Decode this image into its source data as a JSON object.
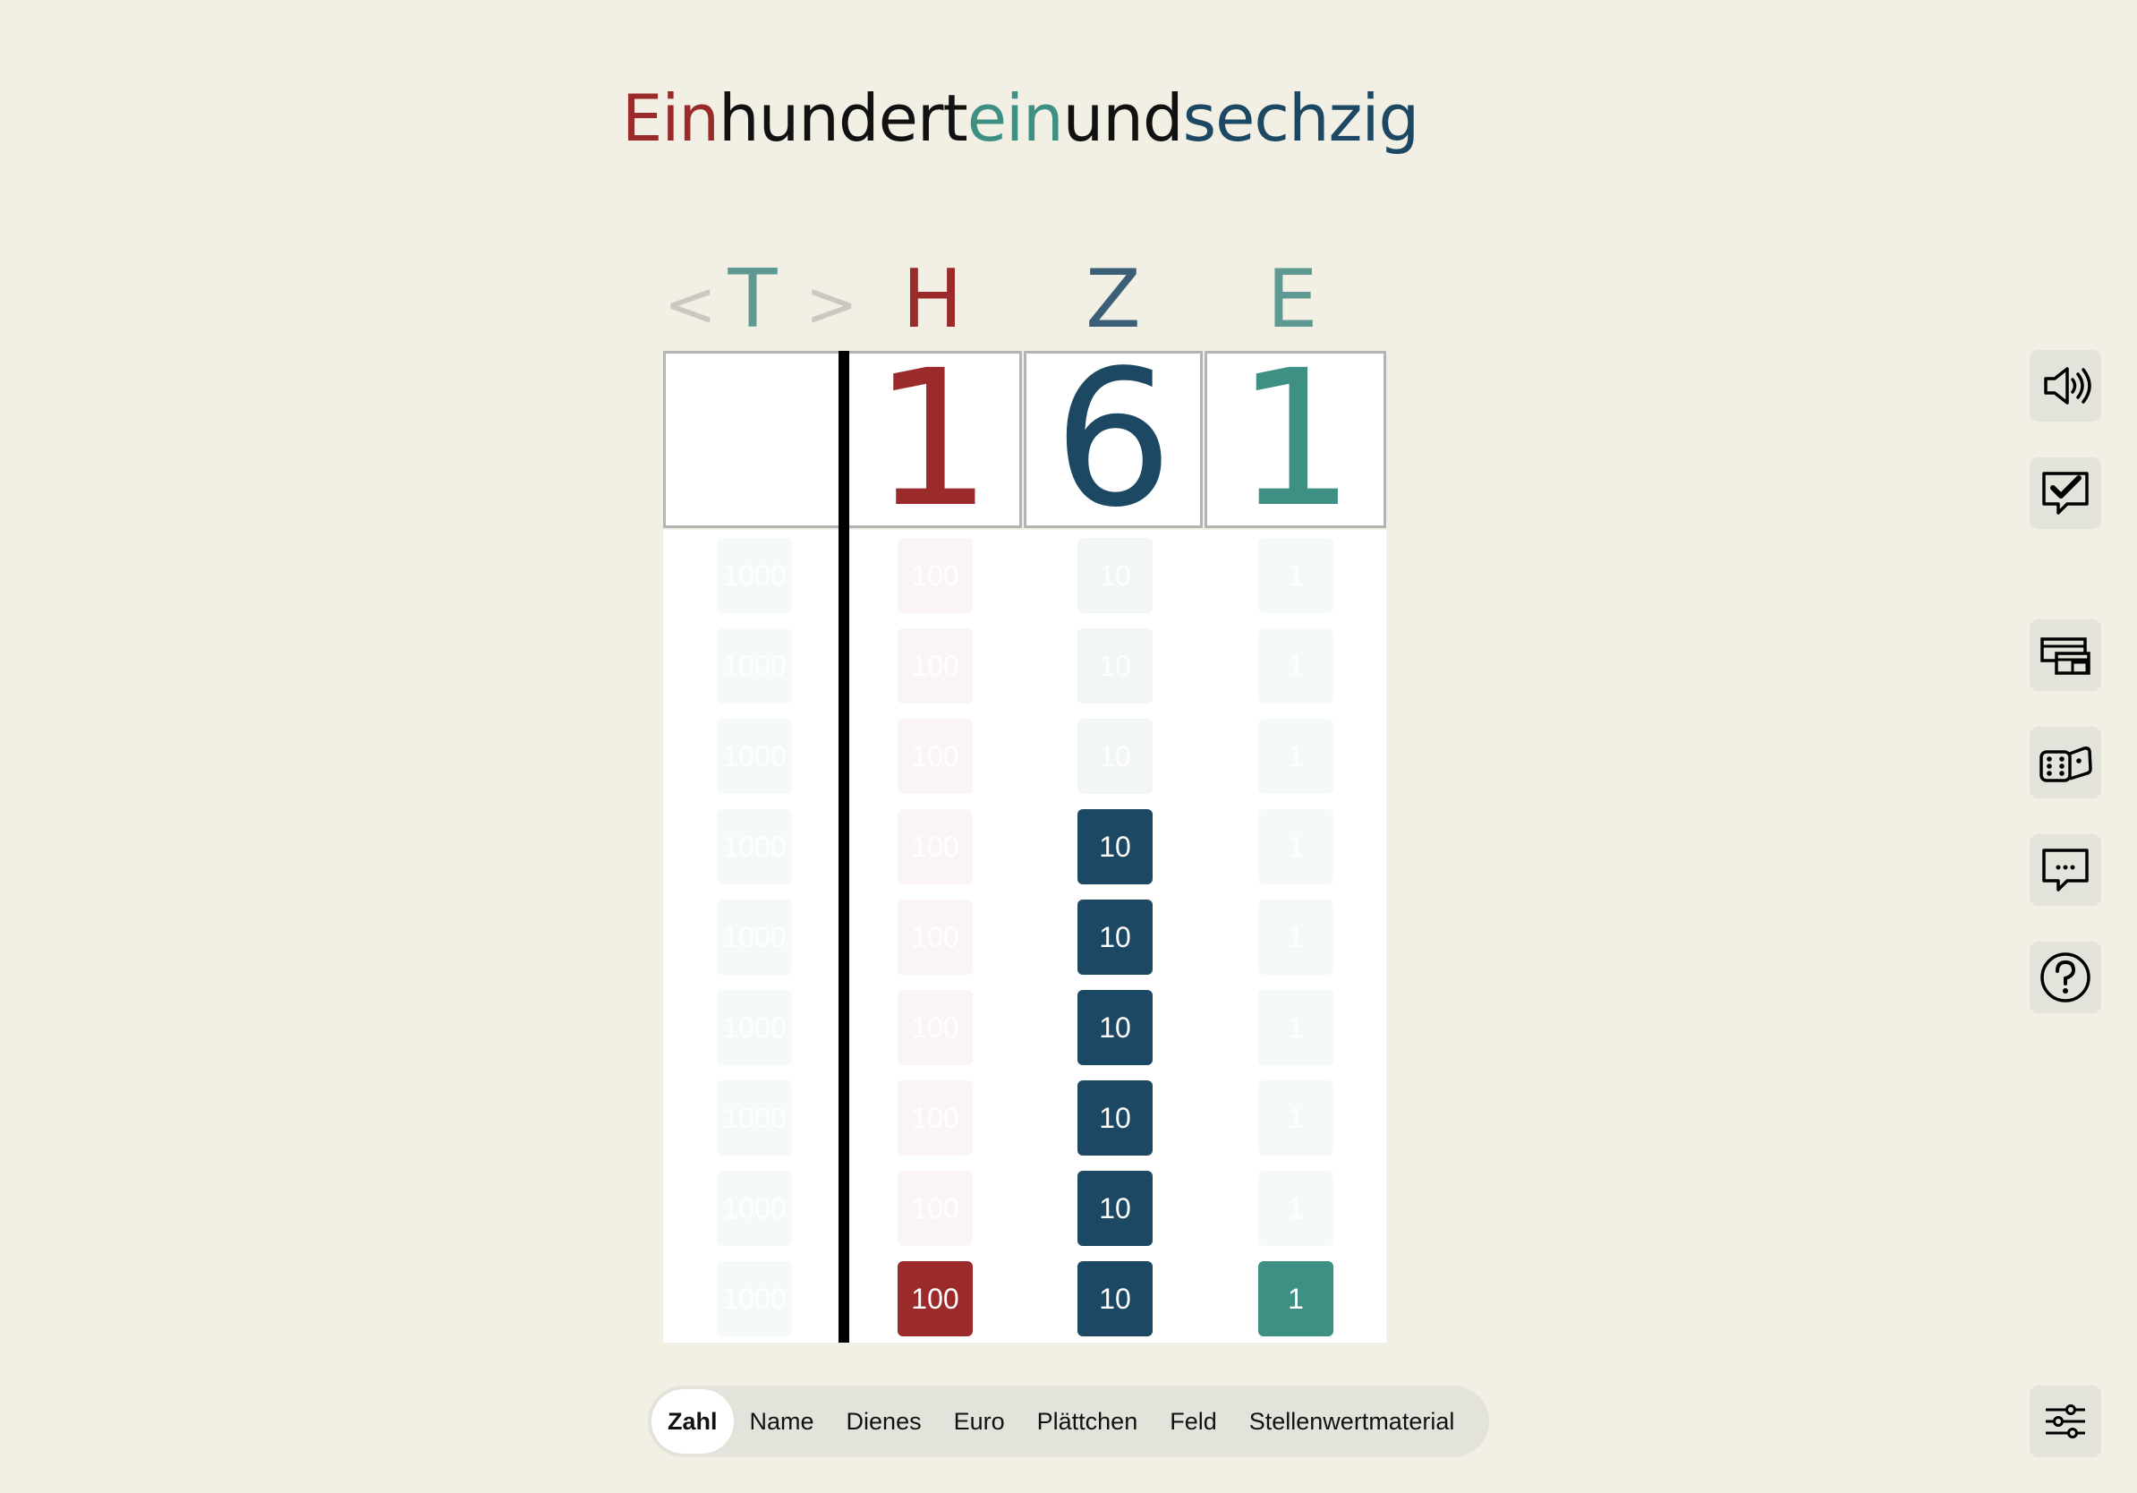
{
  "title": {
    "parts": [
      {
        "text": "Ein",
        "color": "#9b2a2a"
      },
      {
        "text": "hundert",
        "color": "#111111"
      },
      {
        "text": "ein",
        "color": "#3e8f84"
      },
      {
        "text": "und",
        "color": "#111111"
      },
      {
        "text": "sechzig",
        "color": "#1c4863"
      }
    ]
  },
  "columns": [
    {
      "id": "T",
      "label": "T",
      "digit": "",
      "tile_label": "1000",
      "color": "#5e9a92",
      "tile_color": "#3e8f84",
      "count": 0
    },
    {
      "id": "H",
      "label": "H",
      "digit": "1",
      "tile_label": "100",
      "color": "#9b2a2a",
      "tile_color": "#9b2a2a",
      "count": 1
    },
    {
      "id": "Z",
      "label": "Z",
      "digit": "6",
      "tile_label": "10",
      "color": "#3c5f78",
      "tile_color": "#1c4863",
      "count": 6
    },
    {
      "id": "E",
      "label": "E",
      "digit": "1",
      "tile_label": "1",
      "color": "#5e9a92",
      "tile_color": "#3e8f84",
      "count": 1
    }
  ],
  "nav_arrows": {
    "left": "<",
    "right": ">"
  },
  "rows": 9,
  "side_buttons": [
    {
      "name": "speaker-icon"
    },
    {
      "name": "check-speech-icon"
    },
    {
      "name": "window-layout-icon"
    },
    {
      "name": "dice-icon"
    },
    {
      "name": "speech-bubble-icon"
    },
    {
      "name": "help-icon"
    },
    {
      "name": "sliders-icon"
    }
  ],
  "tabs": [
    {
      "label": "Zahl",
      "active": true
    },
    {
      "label": "Name",
      "active": false
    },
    {
      "label": "Dienes",
      "active": false
    },
    {
      "label": "Euro",
      "active": false
    },
    {
      "label": "Plättchen",
      "active": false
    },
    {
      "label": "Feld",
      "active": false
    },
    {
      "label": "Stellenwertmaterial",
      "active": false
    }
  ]
}
